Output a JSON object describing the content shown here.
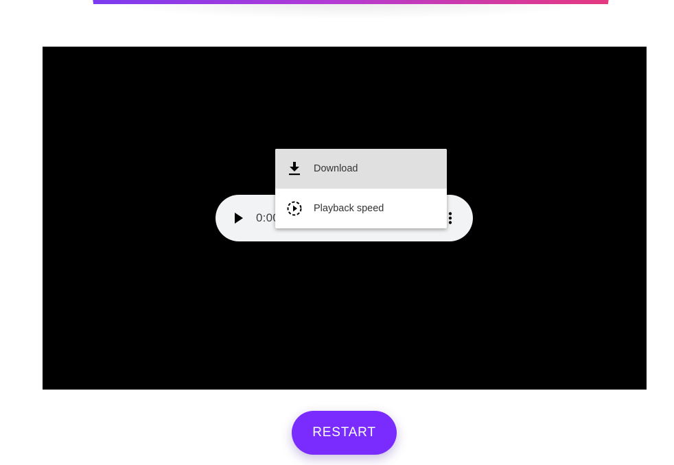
{
  "player": {
    "time_display": "0:00",
    "play_icon": "play-icon",
    "more_icon": "more-vert-icon"
  },
  "menu": {
    "items": [
      {
        "label": "Download",
        "icon": "download-icon",
        "highlighted": true
      },
      {
        "label": "Playback speed",
        "icon": "playback-speed-icon",
        "highlighted": false
      }
    ]
  },
  "restart": {
    "label": "RESTART"
  },
  "colors": {
    "banner_start": "#7b3bf0",
    "banner_end": "#e6397f",
    "video_bg": "#000000",
    "player_bg": "#f1f3f4",
    "menu_highlight": "#e0e0e0",
    "restart_bg": "#7a2cff"
  }
}
